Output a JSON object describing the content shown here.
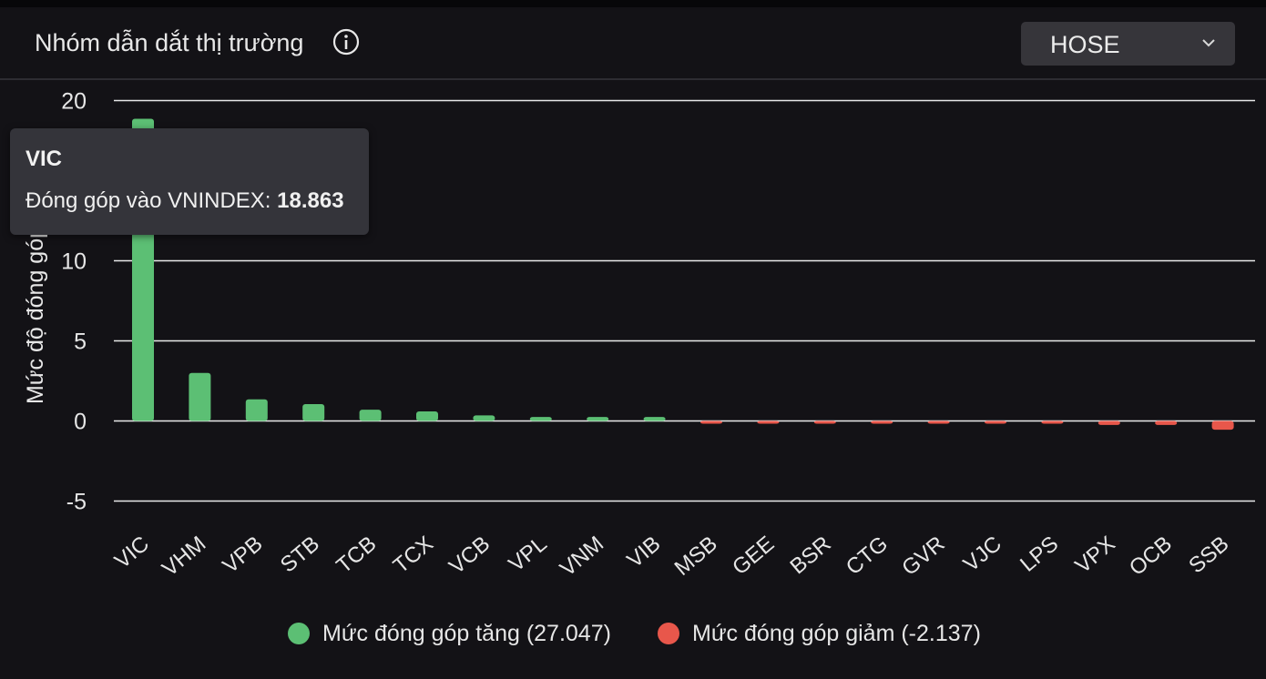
{
  "header": {
    "title": "Nhóm dẫn dắt thị trường",
    "info_icon": "info-circle-icon",
    "exchange_select": {
      "value": "HOSE",
      "icon": "chevron-down-icon"
    }
  },
  "colors": {
    "increase": "#5cbf74",
    "decrease": "#e8574b",
    "grid": "#e9e9e9",
    "background": "#131216"
  },
  "tooltip": {
    "title": "VIC",
    "label": "Đóng góp vào VNINDEX: ",
    "value": "18.863"
  },
  "legend": {
    "increase_label": "Mức đóng góp tăng (27.047)",
    "decrease_label": "Mức đóng góp giảm (-2.137)"
  },
  "chart_data": {
    "type": "bar",
    "title": "Nhóm dẫn dắt thị trường",
    "xlabel": "",
    "ylabel": "Mức độ đóng góp",
    "ylim": [
      -5,
      20
    ],
    "yticks": [
      20,
      10,
      5,
      0,
      -5
    ],
    "grid": true,
    "legend_position": "bottom",
    "categories": [
      "VIC",
      "VHM",
      "VPB",
      "STB",
      "TCB",
      "TCX",
      "VCB",
      "VPL",
      "VNM",
      "VIB",
      "MSB",
      "GEE",
      "BSR",
      "CTG",
      "GVR",
      "VJC",
      "LPS",
      "VPX",
      "OCB",
      "SSB"
    ],
    "values": [
      18.863,
      3.0,
      1.35,
      1.05,
      0.7,
      0.6,
      0.35,
      0.25,
      0.25,
      0.25,
      -0.12,
      -0.1,
      -0.1,
      -0.1,
      -0.1,
      -0.12,
      -0.12,
      -0.25,
      -0.25,
      -0.55
    ]
  }
}
